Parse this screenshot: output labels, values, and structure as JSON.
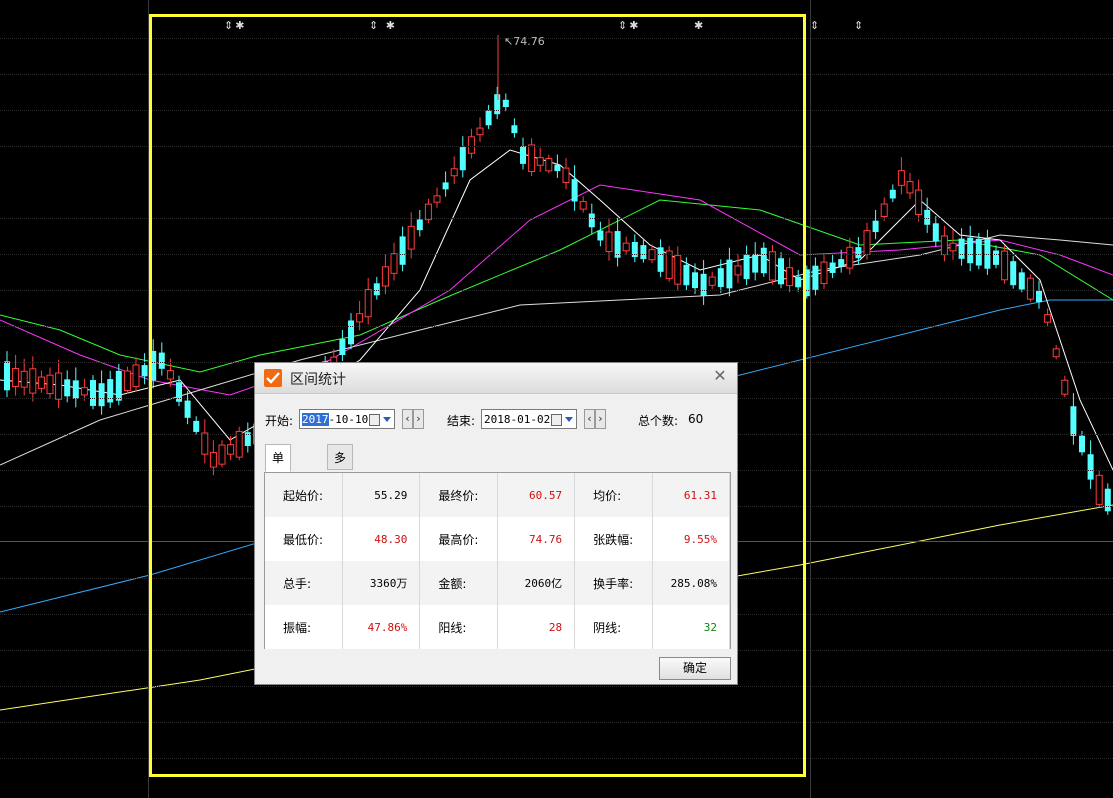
{
  "chart": {
    "peak_label": "↖74.76",
    "markers": [
      {
        "text": "⇕✱"
      },
      {
        "text": "⇕ ✱"
      },
      {
        "text": "⇕✱"
      },
      {
        "text": "✱"
      },
      {
        "text": "⇕"
      },
      {
        "text": "⇕"
      }
    ],
    "colors": {
      "up": "#ff3b3b",
      "down": "#54ffff",
      "ma5": "#ffffff",
      "ma10": "#ffff66",
      "ma20": "#ff33ff",
      "ma60": "#33ff33",
      "ma120": "#33aaff",
      "selection": "#ffff33"
    }
  },
  "dialog": {
    "title": "区间统计",
    "close": "✕",
    "start_label": "开始:",
    "start_date_sel": "2017",
    "start_date_rest": "-10-10",
    "end_label": "结束:",
    "end_date": "2018-01-02",
    "prev": "‹",
    "next": "›",
    "total_label": "总个数:",
    "total_value": "60",
    "tabs": [
      "单股统计",
      "多股比较"
    ],
    "stats": [
      [
        {
          "k": "起始价:",
          "v": "55.29",
          "c": "black"
        },
        {
          "k": "最终价:",
          "v": "60.57",
          "c": "red"
        },
        {
          "k": "均价:",
          "v": "61.31",
          "c": "red"
        }
      ],
      [
        {
          "k": "最低价:",
          "v": "48.30",
          "c": "red"
        },
        {
          "k": "最高价:",
          "v": "74.76",
          "c": "red"
        },
        {
          "k": "张跌幅:",
          "v": "9.55%",
          "c": "red"
        }
      ],
      [
        {
          "k": "总手:",
          "v": "3360万",
          "c": "black"
        },
        {
          "k": "金额:",
          "v": "2060亿",
          "c": "black"
        },
        {
          "k": "换手率:",
          "v": "285.08%",
          "c": "black"
        }
      ],
      [
        {
          "k": "振幅:",
          "v": "47.86%",
          "c": "red"
        },
        {
          "k": "阳线:",
          "v": "28",
          "c": "red"
        },
        {
          "k": "阴线:",
          "v": "32",
          "c": "green"
        }
      ]
    ],
    "ok": "确定"
  }
}
